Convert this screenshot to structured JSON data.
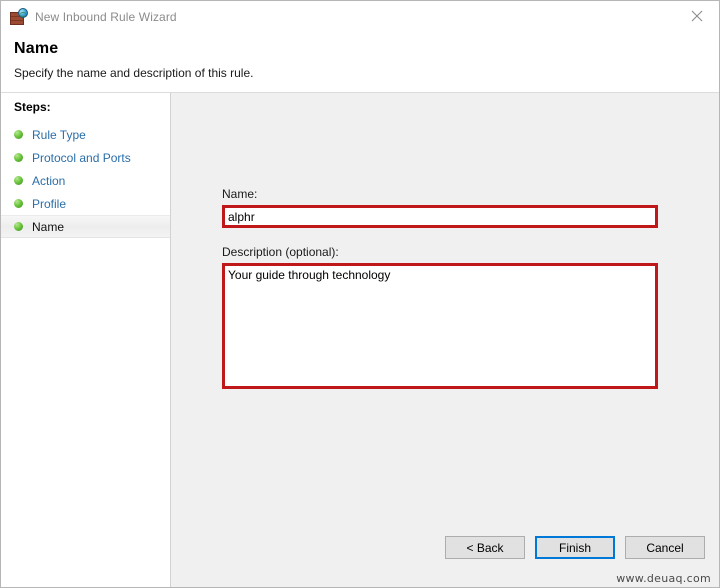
{
  "window": {
    "title": "New Inbound Rule Wizard",
    "icon": "firewall-globe-icon",
    "close_label": "✕"
  },
  "header": {
    "title": "Name",
    "subtitle": "Specify the name and description of this rule."
  },
  "sidebar": {
    "heading": "Steps:",
    "items": [
      {
        "label": "Rule Type",
        "state": "done"
      },
      {
        "label": "Protocol and Ports",
        "state": "done"
      },
      {
        "label": "Action",
        "state": "done"
      },
      {
        "label": "Profile",
        "state": "done"
      },
      {
        "label": "Name",
        "state": "current"
      }
    ]
  },
  "form": {
    "name_label": "Name:",
    "name_value": "alphr",
    "name_placeholder": "",
    "description_label": "Description (optional):",
    "description_value": "Your guide through technology",
    "description_placeholder": ""
  },
  "footer": {
    "back_label": "< Back",
    "finish_label": "Finish",
    "cancel_label": "Cancel"
  },
  "watermark": {
    "text": "www.deuaq.com"
  },
  "colors": {
    "annotation_red": "#c01818",
    "link_blue": "#2a6ea8",
    "focus_blue": "#0078d7",
    "bullet_green": "#67c23a",
    "content_gray": "#f0f0f0"
  }
}
